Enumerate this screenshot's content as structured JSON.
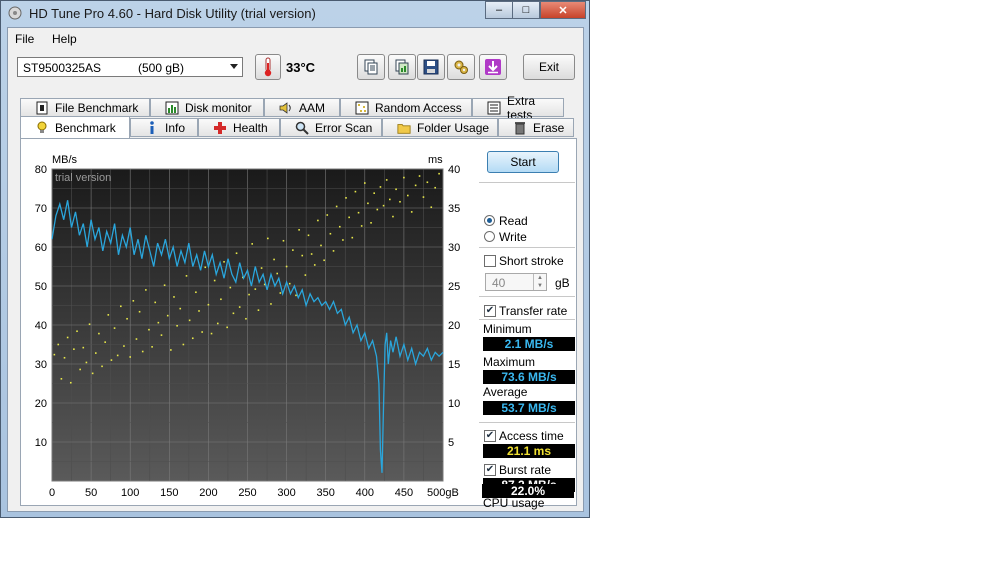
{
  "window": {
    "title": "HD Tune Pro 4.60 - Hard Disk Utility (trial version)",
    "buttons": {
      "minimize": "–",
      "maximize": "□",
      "close": "✕"
    }
  },
  "menu": {
    "file": "File",
    "help": "Help"
  },
  "toolbar": {
    "drive_name": "ST9500325AS",
    "drive_size": "(500 gB)",
    "temperature": "33°C",
    "exit_label": "Exit",
    "icons": [
      "copy-text-icon",
      "copy-screenshot-icon",
      "save-icon",
      "options-icon",
      "download-icon"
    ]
  },
  "tabs_top": [
    "File Benchmark",
    "Disk monitor",
    "AAM",
    "Random Access",
    "Extra tests"
  ],
  "tabs_bottom": [
    "Benchmark",
    "Info",
    "Health",
    "Error Scan",
    "Folder Usage",
    "Erase"
  ],
  "active_tab": "Benchmark",
  "controls": {
    "start_label": "Start",
    "read_label": "Read",
    "write_label": "Write",
    "mode": "Read",
    "short_stroke_label": "Short stroke",
    "short_stroke_checked": false,
    "short_stroke_value": "40",
    "short_stroke_unit": "gB",
    "transfer_rate_label": "Transfer rate",
    "transfer_rate_checked": true,
    "access_time_label": "Access time",
    "access_time_checked": true,
    "burst_rate_label": "Burst rate",
    "burst_rate_checked": true
  },
  "results": {
    "minimum_label": "Minimum",
    "minimum": "2.1 MB/s",
    "maximum_label": "Maximum",
    "maximum": "73.6 MB/s",
    "average_label": "Average",
    "average": "53.7 MB/s",
    "access_time": "21.1 ms",
    "burst_rate": "87.2 MB/s",
    "cpu_label": "CPU usage",
    "cpu": "22.0%"
  },
  "colors": {
    "transfer_line": "#2aa6dc",
    "access_dots": "#e8e84a",
    "readout_blue": "#3ab8f0",
    "readout_yellow": "#f0e030",
    "readout_white": "#ffffff"
  },
  "chart_data": {
    "type": "line",
    "watermark": "trial version",
    "ylabel_left": "MB/s",
    "ylabel_right": "ms",
    "xunit": "gB",
    "xlim": [
      0,
      500
    ],
    "ylim_left": [
      0,
      80
    ],
    "ylim_right": [
      0,
      40
    ],
    "x_ticks": [
      "0",
      "50",
      "100",
      "150",
      "200",
      "250",
      "300",
      "350",
      "400",
      "450",
      "500gB"
    ],
    "y_ticks_left": [
      "10",
      "20",
      "30",
      "40",
      "50",
      "60",
      "70",
      "80"
    ],
    "y_ticks_right": [
      "5",
      "10",
      "15",
      "20",
      "25",
      "30",
      "35",
      "40"
    ],
    "grid": true,
    "series": [
      {
        "name": "Transfer rate",
        "axis": "left",
        "points": [
          [
            0,
            62
          ],
          [
            5,
            68
          ],
          [
            10,
            71
          ],
          [
            15,
            67
          ],
          [
            20,
            72
          ],
          [
            25,
            65
          ],
          [
            30,
            69
          ],
          [
            35,
            63
          ],
          [
            40,
            66
          ],
          [
            45,
            60
          ],
          [
            50,
            67
          ],
          [
            55,
            62
          ],
          [
            60,
            65
          ],
          [
            65,
            59
          ],
          [
            70,
            64
          ],
          [
            75,
            61
          ],
          [
            80,
            66
          ],
          [
            85,
            58
          ],
          [
            90,
            63
          ],
          [
            95,
            60
          ],
          [
            100,
            65
          ],
          [
            105,
            58
          ],
          [
            110,
            62
          ],
          [
            115,
            57
          ],
          [
            120,
            63
          ],
          [
            125,
            59
          ],
          [
            130,
            55
          ],
          [
            135,
            61
          ],
          [
            140,
            58
          ],
          [
            145,
            62
          ],
          [
            150,
            57
          ],
          [
            155,
            60
          ],
          [
            160,
            55
          ],
          [
            165,
            59
          ],
          [
            170,
            56
          ],
          [
            175,
            61
          ],
          [
            180,
            55
          ],
          [
            185,
            58
          ],
          [
            190,
            54
          ],
          [
            195,
            59
          ],
          [
            200,
            55
          ],
          [
            205,
            58
          ],
          [
            210,
            53
          ],
          [
            215,
            56
          ],
          [
            220,
            52
          ],
          [
            225,
            57
          ],
          [
            230,
            53
          ],
          [
            235,
            51
          ],
          [
            240,
            56
          ],
          [
            245,
            52
          ],
          [
            250,
            54
          ],
          [
            255,
            50
          ],
          [
            260,
            55
          ],
          [
            265,
            51
          ],
          [
            270,
            53
          ],
          [
            275,
            49
          ],
          [
            280,
            53
          ],
          [
            285,
            50
          ],
          [
            290,
            52
          ],
          [
            295,
            48
          ],
          [
            300,
            51
          ],
          [
            305,
            48
          ],
          [
            310,
            50
          ],
          [
            315,
            47
          ],
          [
            320,
            49
          ],
          [
            325,
            45
          ],
          [
            330,
            48
          ],
          [
            335,
            46
          ],
          [
            340,
            47
          ],
          [
            345,
            45
          ],
          [
            350,
            46
          ],
          [
            355,
            44
          ],
          [
            360,
            46
          ],
          [
            365,
            43
          ],
          [
            370,
            44
          ],
          [
            375,
            40
          ],
          [
            380,
            42
          ],
          [
            385,
            38
          ],
          [
            390,
            40
          ],
          [
            395,
            36
          ],
          [
            400,
            38
          ],
          [
            405,
            34
          ],
          [
            410,
            36
          ],
          [
            415,
            32
          ],
          [
            418,
            25
          ],
          [
            420,
            8
          ],
          [
            422,
            2.1
          ],
          [
            424,
            20
          ],
          [
            426,
            35
          ],
          [
            428,
            38
          ],
          [
            430,
            30
          ],
          [
            433,
            36
          ],
          [
            436,
            33
          ],
          [
            440,
            37
          ],
          [
            445,
            32
          ],
          [
            450,
            35
          ],
          [
            455,
            31
          ],
          [
            460,
            34
          ],
          [
            465,
            30
          ],
          [
            470,
            33
          ],
          [
            475,
            32
          ],
          [
            480,
            34
          ],
          [
            485,
            31
          ],
          [
            490,
            33
          ],
          [
            495,
            32
          ],
          [
            500,
            33
          ]
        ]
      },
      {
        "name": "Access time",
        "axis": "right",
        "points": [
          [
            3,
            16.2
          ],
          [
            8,
            17.5
          ],
          [
            12,
            13.1
          ],
          [
            16,
            15.8
          ],
          [
            20,
            18.4
          ],
          [
            24,
            12.6
          ],
          [
            28,
            16.9
          ],
          [
            32,
            19.2
          ],
          [
            36,
            14.3
          ],
          [
            40,
            17.1
          ],
          [
            44,
            15.2
          ],
          [
            48,
            20.1
          ],
          [
            52,
            13.8
          ],
          [
            56,
            16.4
          ],
          [
            60,
            18.9
          ],
          [
            64,
            14.7
          ],
          [
            68,
            17.8
          ],
          [
            72,
            21.3
          ],
          [
            76,
            15.5
          ],
          [
            80,
            19.6
          ],
          [
            84,
            16.1
          ],
          [
            88,
            22.4
          ],
          [
            92,
            17.3
          ],
          [
            96,
            20.8
          ],
          [
            100,
            15.9
          ],
          [
            104,
            23.1
          ],
          [
            108,
            18.2
          ],
          [
            112,
            21.7
          ],
          [
            116,
            16.6
          ],
          [
            120,
            24.5
          ],
          [
            124,
            19.4
          ],
          [
            128,
            17.2
          ],
          [
            132,
            22.9
          ],
          [
            136,
            20.3
          ],
          [
            140,
            18.7
          ],
          [
            144,
            25.1
          ],
          [
            148,
            21.2
          ],
          [
            152,
            16.8
          ],
          [
            156,
            23.6
          ],
          [
            160,
            19.9
          ],
          [
            164,
            22.1
          ],
          [
            168,
            17.5
          ],
          [
            172,
            26.3
          ],
          [
            176,
            20.6
          ],
          [
            180,
            18.3
          ],
          [
            184,
            24.2
          ],
          [
            188,
            21.8
          ],
          [
            192,
            19.1
          ],
          [
            196,
            27.4
          ],
          [
            200,
            22.6
          ],
          [
            204,
            18.9
          ],
          [
            208,
            25.7
          ],
          [
            212,
            20.2
          ],
          [
            216,
            23.3
          ],
          [
            220,
            28.1
          ],
          [
            224,
            19.7
          ],
          [
            228,
            24.8
          ],
          [
            232,
            21.5
          ],
          [
            236,
            29.2
          ],
          [
            240,
            22.3
          ],
          [
            244,
            26.1
          ],
          [
            248,
            20.8
          ],
          [
            252,
            23.9
          ],
          [
            256,
            30.4
          ],
          [
            260,
            24.6
          ],
          [
            264,
            21.9
          ],
          [
            268,
            27.3
          ],
          [
            272,
            25.2
          ],
          [
            276,
            31.1
          ],
          [
            280,
            22.7
          ],
          [
            284,
            28.4
          ],
          [
            288,
            26.6
          ],
          [
            292,
            24.1
          ],
          [
            296,
            30.8
          ],
          [
            300,
            27.5
          ],
          [
            304,
            25.3
          ],
          [
            308,
            29.6
          ],
          [
            312,
            23.8
          ],
          [
            316,
            32.2
          ],
          [
            320,
            28.9
          ],
          [
            324,
            26.4
          ],
          [
            328,
            31.5
          ],
          [
            332,
            29.1
          ],
          [
            336,
            27.7
          ],
          [
            340,
            33.4
          ],
          [
            344,
            30.2
          ],
          [
            348,
            28.3
          ],
          [
            352,
            34.1
          ],
          [
            356,
            31.7
          ],
          [
            360,
            29.5
          ],
          [
            364,
            35.2
          ],
          [
            368,
            32.6
          ],
          [
            372,
            30.9
          ],
          [
            376,
            36.3
          ],
          [
            380,
            33.8
          ],
          [
            384,
            31.2
          ],
          [
            388,
            37.1
          ],
          [
            392,
            34.4
          ],
          [
            396,
            32.7
          ],
          [
            400,
            38.2
          ],
          [
            404,
            35.6
          ],
          [
            408,
            33.1
          ],
          [
            412,
            36.9
          ],
          [
            416,
            34.8
          ],
          [
            420,
            37.7
          ],
          [
            424,
            35.3
          ],
          [
            428,
            38.6
          ],
          [
            432,
            36.1
          ],
          [
            436,
            33.9
          ],
          [
            440,
            37.4
          ],
          [
            445,
            35.8
          ],
          [
            450,
            38.9
          ],
          [
            455,
            36.6
          ],
          [
            460,
            34.5
          ],
          [
            465,
            37.9
          ],
          [
            470,
            39.1
          ],
          [
            475,
            36.4
          ],
          [
            480,
            38.3
          ],
          [
            485,
            35.1
          ],
          [
            490,
            37.6
          ],
          [
            495,
            39.4
          ]
        ]
      }
    ]
  }
}
